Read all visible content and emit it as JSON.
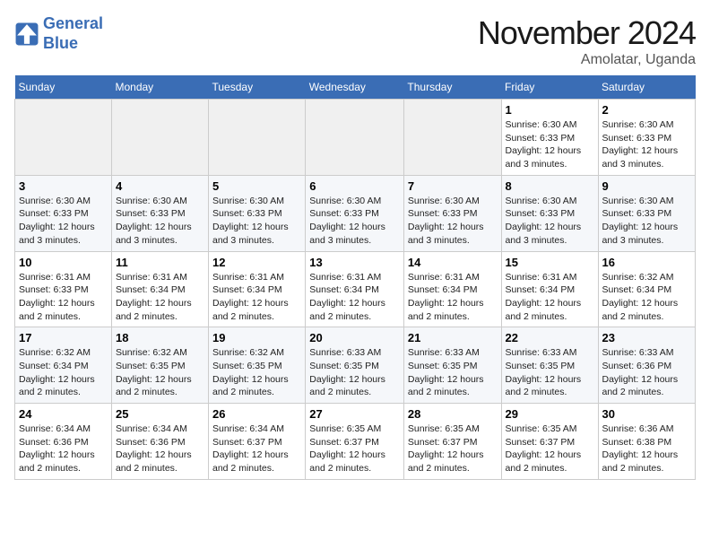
{
  "logo": {
    "line1": "General",
    "line2": "Blue"
  },
  "title": "November 2024",
  "location": "Amolatar, Uganda",
  "days_header": [
    "Sunday",
    "Monday",
    "Tuesday",
    "Wednesday",
    "Thursday",
    "Friday",
    "Saturday"
  ],
  "weeks": [
    [
      {
        "day": "",
        "info": ""
      },
      {
        "day": "",
        "info": ""
      },
      {
        "day": "",
        "info": ""
      },
      {
        "day": "",
        "info": ""
      },
      {
        "day": "",
        "info": ""
      },
      {
        "day": "1",
        "info": "Sunrise: 6:30 AM\nSunset: 6:33 PM\nDaylight: 12 hours and 3 minutes."
      },
      {
        "day": "2",
        "info": "Sunrise: 6:30 AM\nSunset: 6:33 PM\nDaylight: 12 hours and 3 minutes."
      }
    ],
    [
      {
        "day": "3",
        "info": "Sunrise: 6:30 AM\nSunset: 6:33 PM\nDaylight: 12 hours and 3 minutes."
      },
      {
        "day": "4",
        "info": "Sunrise: 6:30 AM\nSunset: 6:33 PM\nDaylight: 12 hours and 3 minutes."
      },
      {
        "day": "5",
        "info": "Sunrise: 6:30 AM\nSunset: 6:33 PM\nDaylight: 12 hours and 3 minutes."
      },
      {
        "day": "6",
        "info": "Sunrise: 6:30 AM\nSunset: 6:33 PM\nDaylight: 12 hours and 3 minutes."
      },
      {
        "day": "7",
        "info": "Sunrise: 6:30 AM\nSunset: 6:33 PM\nDaylight: 12 hours and 3 minutes."
      },
      {
        "day": "8",
        "info": "Sunrise: 6:30 AM\nSunset: 6:33 PM\nDaylight: 12 hours and 3 minutes."
      },
      {
        "day": "9",
        "info": "Sunrise: 6:30 AM\nSunset: 6:33 PM\nDaylight: 12 hours and 3 minutes."
      }
    ],
    [
      {
        "day": "10",
        "info": "Sunrise: 6:31 AM\nSunset: 6:33 PM\nDaylight: 12 hours and 2 minutes."
      },
      {
        "day": "11",
        "info": "Sunrise: 6:31 AM\nSunset: 6:34 PM\nDaylight: 12 hours and 2 minutes."
      },
      {
        "day": "12",
        "info": "Sunrise: 6:31 AM\nSunset: 6:34 PM\nDaylight: 12 hours and 2 minutes."
      },
      {
        "day": "13",
        "info": "Sunrise: 6:31 AM\nSunset: 6:34 PM\nDaylight: 12 hours and 2 minutes."
      },
      {
        "day": "14",
        "info": "Sunrise: 6:31 AM\nSunset: 6:34 PM\nDaylight: 12 hours and 2 minutes."
      },
      {
        "day": "15",
        "info": "Sunrise: 6:31 AM\nSunset: 6:34 PM\nDaylight: 12 hours and 2 minutes."
      },
      {
        "day": "16",
        "info": "Sunrise: 6:32 AM\nSunset: 6:34 PM\nDaylight: 12 hours and 2 minutes."
      }
    ],
    [
      {
        "day": "17",
        "info": "Sunrise: 6:32 AM\nSunset: 6:34 PM\nDaylight: 12 hours and 2 minutes."
      },
      {
        "day": "18",
        "info": "Sunrise: 6:32 AM\nSunset: 6:35 PM\nDaylight: 12 hours and 2 minutes."
      },
      {
        "day": "19",
        "info": "Sunrise: 6:32 AM\nSunset: 6:35 PM\nDaylight: 12 hours and 2 minutes."
      },
      {
        "day": "20",
        "info": "Sunrise: 6:33 AM\nSunset: 6:35 PM\nDaylight: 12 hours and 2 minutes."
      },
      {
        "day": "21",
        "info": "Sunrise: 6:33 AM\nSunset: 6:35 PM\nDaylight: 12 hours and 2 minutes."
      },
      {
        "day": "22",
        "info": "Sunrise: 6:33 AM\nSunset: 6:35 PM\nDaylight: 12 hours and 2 minutes."
      },
      {
        "day": "23",
        "info": "Sunrise: 6:33 AM\nSunset: 6:36 PM\nDaylight: 12 hours and 2 minutes."
      }
    ],
    [
      {
        "day": "24",
        "info": "Sunrise: 6:34 AM\nSunset: 6:36 PM\nDaylight: 12 hours and 2 minutes."
      },
      {
        "day": "25",
        "info": "Sunrise: 6:34 AM\nSunset: 6:36 PM\nDaylight: 12 hours and 2 minutes."
      },
      {
        "day": "26",
        "info": "Sunrise: 6:34 AM\nSunset: 6:37 PM\nDaylight: 12 hours and 2 minutes."
      },
      {
        "day": "27",
        "info": "Sunrise: 6:35 AM\nSunset: 6:37 PM\nDaylight: 12 hours and 2 minutes."
      },
      {
        "day": "28",
        "info": "Sunrise: 6:35 AM\nSunset: 6:37 PM\nDaylight: 12 hours and 2 minutes."
      },
      {
        "day": "29",
        "info": "Sunrise: 6:35 AM\nSunset: 6:37 PM\nDaylight: 12 hours and 2 minutes."
      },
      {
        "day": "30",
        "info": "Sunrise: 6:36 AM\nSunset: 6:38 PM\nDaylight: 12 hours and 2 minutes."
      }
    ]
  ]
}
